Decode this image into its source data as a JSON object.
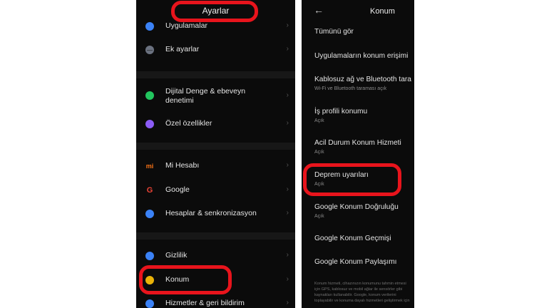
{
  "left_screen": {
    "title": "Ayarlar",
    "items": [
      {
        "label": "Uygulamalar",
        "icon": "apps-icon",
        "color": "#3b82f6"
      },
      {
        "label": "Ek ayarlar",
        "icon": "more-icon",
        "color": "#9ca3af"
      },
      {
        "label": "Dijital Denge & ebeveyn denetimi",
        "icon": "digital-wellbeing-icon",
        "color": "#22c55e"
      },
      {
        "label": "Özel özellikler",
        "icon": "special-features-icon",
        "color": "#8b5cf6"
      },
      {
        "label": "Mi Hesabı",
        "icon": "mi-icon",
        "color": "#f97316"
      },
      {
        "label": "Google",
        "icon": "google-icon",
        "color": "#ea4335"
      },
      {
        "label": "Hesaplar & senkronizasyon",
        "icon": "account-icon",
        "color": "#3b82f6"
      },
      {
        "label": "Gizlilik",
        "icon": "eye-icon",
        "color": "#3b82f6"
      },
      {
        "label": "Konum",
        "icon": "location-icon",
        "color": "#eab308"
      },
      {
        "label": "Hizmetler & geri bildirim",
        "icon": "services-icon",
        "color": "#3b82f6"
      }
    ]
  },
  "right_screen": {
    "title": "Konum",
    "items": [
      {
        "title": "Tümünü gör",
        "subtitle": ""
      },
      {
        "title": "Uygulamaların konum erişimi",
        "subtitle": ""
      },
      {
        "title": "Kablosuz ağ ve Bluetooth tara",
        "subtitle": "Wi-Fi ve Bluetooth taraması açık"
      },
      {
        "title": "İş profili konumu",
        "subtitle": "Açık"
      },
      {
        "title": "Acil Durum Konum Hizmeti",
        "subtitle": "Açık"
      },
      {
        "title": "Deprem uyarıları",
        "subtitle": "Açık"
      },
      {
        "title": "Google Konum Doğruluğu",
        "subtitle": "Açık"
      },
      {
        "title": "Google Konum Geçmişi",
        "subtitle": ""
      },
      {
        "title": "Google Konum Paylaşımı",
        "subtitle": ""
      }
    ],
    "footnote": "Konum hizmeti, cihazınızın konumunu tahmin etmesi için GPS, kablosuz ve mobil ağlar ile sensörler gibi kaynakları kullanabilir. Google, konum verilerini toplayabilir ve konuma dayalı hizmetleri geliştirmek için"
  },
  "colors": {
    "highlight": "#e8141c",
    "background": "#0b0b0b"
  }
}
